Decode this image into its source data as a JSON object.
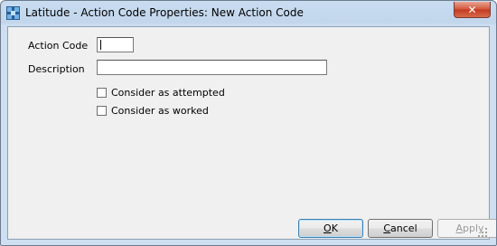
{
  "window": {
    "title": "Latitude - Action Code Properties: New Action Code",
    "close_glyph": "✕",
    "app_icon": "latitude-app-icon"
  },
  "form": {
    "action_code": {
      "label": "Action Code",
      "value": ""
    },
    "description": {
      "label": "Description",
      "value": ""
    },
    "attempted": {
      "label": "Consider as attempted",
      "checked": false
    },
    "worked": {
      "label": "Consider as worked",
      "checked": false
    }
  },
  "buttons": {
    "ok": {
      "label": "OK",
      "mnemonic": "O",
      "rest": "K"
    },
    "cancel": {
      "label": "Cancel",
      "mnemonic": "C",
      "rest": "ancel"
    },
    "apply": {
      "label": "Apply",
      "mnemonic": "A",
      "rest": "pply",
      "enabled": false
    }
  },
  "colors": {
    "titlebar": "#c2d6ec",
    "client": "#f0f0f0",
    "close": "#c33a20"
  }
}
